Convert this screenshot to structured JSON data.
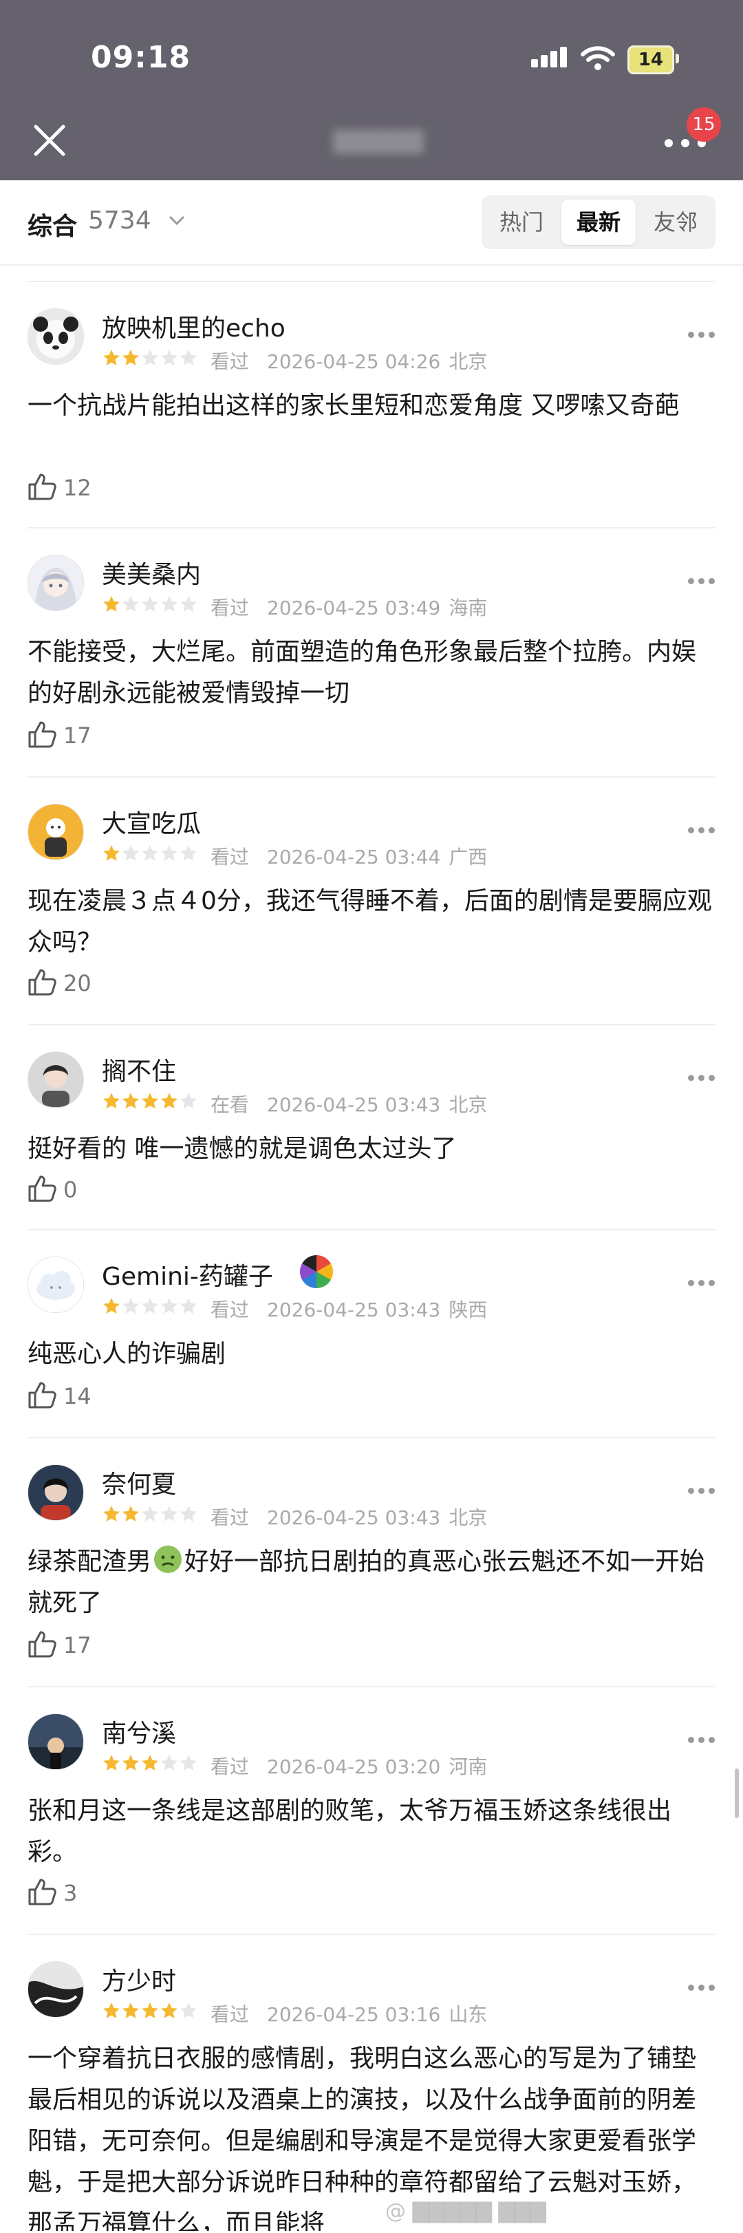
{
  "status": {
    "time": "09:18",
    "battery": "14"
  },
  "nav": {
    "badge_count": "15"
  },
  "filter": {
    "label": "综合",
    "count": "5734",
    "tabs": [
      {
        "label": "热门",
        "active": false
      },
      {
        "label": "最新",
        "active": true
      },
      {
        "label": "友邻",
        "active": false
      }
    ]
  },
  "colors": {
    "star_filled": "#f5b82e",
    "star_empty": "#e6e6e6",
    "header_bg": "#65626d"
  },
  "reviews": [
    {
      "user": "放映机里的echo",
      "rating": 2,
      "status": "看过",
      "date": "2026-04-25 04:26",
      "location": "北京",
      "content": "一个抗战片能拍出这样的家长里短和恋爱角度 又啰嗦又奇葩",
      "likes": "12"
    },
    {
      "user": "美美桑内",
      "rating": 1,
      "status": "看过",
      "date": "2026-04-25 03:49",
      "location": "海南",
      "content": "不能接受，大烂尾。前面塑造的角色形象最后整个拉胯。内娱的好剧永远能被爱情毁掉一切",
      "likes": "17"
    },
    {
      "user": "大宣吃瓜",
      "rating": 1,
      "status": "看过",
      "date": "2026-04-25 03:44",
      "location": "广西",
      "content": "现在凌晨３点４0分，我还气得睡不着，后面的剧情是要膈应观众吗？",
      "likes": "20"
    },
    {
      "user": "搁不住",
      "rating": 4,
      "status": "在看",
      "date": "2026-04-25 03:43",
      "location": "北京",
      "content": "挺好看的 唯一遗憾的就是调色太过头了",
      "likes": "0"
    },
    {
      "user": "Gemini-药罐子",
      "rating": 1,
      "status": "看过",
      "date": "2026-04-25 03:43",
      "location": "陕西",
      "content": "纯恶心人的诈骗剧",
      "likes": "14"
    },
    {
      "user": "奈何夏",
      "rating": 2,
      "status": "看过",
      "date": "2026-04-25 03:43",
      "location": "北京",
      "content_before": "绿茶配渣男",
      "content_after": "好好一部抗日剧拍的真恶心张云魁还不如一开始就死了",
      "likes": "17"
    },
    {
      "user": "南兮溪",
      "rating": 3,
      "status": "看过",
      "date": "2026-04-25 03:20",
      "location": "河南",
      "content": "张和月这一条线是这部剧的败笔，太爷万福玉娇这条线很出彩。",
      "likes": "3"
    },
    {
      "user": "方少时",
      "rating": 4,
      "status": "看过",
      "date": "2026-04-25 03:16",
      "location": "山东",
      "content": "一个穿着抗日衣服的感情剧，我明白这么恶心的写是为了铺垫最后相见的诉说以及酒桌上的演技，以及什么战争面前的阴差阳错，无可奈何。但是编剧和导演是不是觉得大家更爱看张学魁，于是把大部分诉说昨日种种的章符都留给了云魁对玉娇，那孟万福算什么，而且能将"
    }
  ]
}
